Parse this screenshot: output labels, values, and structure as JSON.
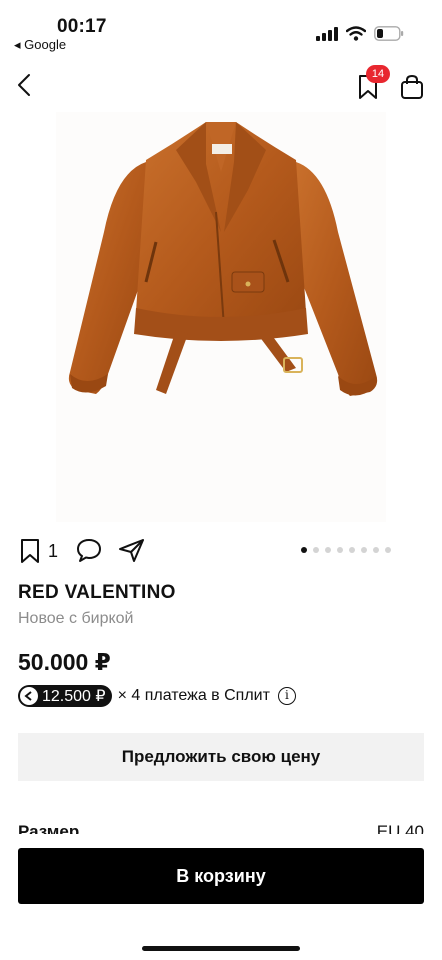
{
  "status_bar": {
    "time": "00:17",
    "back_app": "◂ Google"
  },
  "nav": {
    "bookmark_badge": "14",
    "back_icon": "chevron-left-icon",
    "bookmark_icon": "bookmark-icon",
    "cart_icon": "shopping-bag-icon"
  },
  "product": {
    "image_description_icon": "jacket-photo",
    "likes": "1",
    "carousel_total": 8,
    "carousel_active": 0,
    "brand": "RED VALENTINO",
    "condition": "Новое с биркой",
    "price": "50.000 ₽",
    "split": {
      "installment": "12.500 ₽",
      "text": "× 4 платежа в Сплит",
      "info": "i"
    },
    "offer_button": "Предложить свою цену",
    "spec": {
      "label": "Размер",
      "value": "EU 40"
    }
  },
  "footer": {
    "cart_button": "В корзину"
  },
  "colors": {
    "badge": "#e8272f",
    "jacket": "#b45a1c",
    "button_dark": "#000000",
    "button_light": "#f2f2f2"
  }
}
